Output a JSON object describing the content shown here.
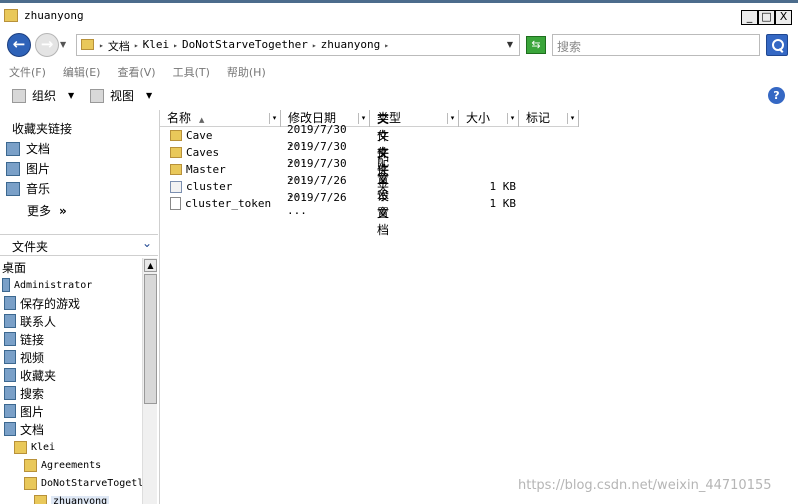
{
  "window": {
    "title": "zhuanyong",
    "minimize": "_",
    "maximize": "□",
    "close": "X"
  },
  "address": {
    "crumbs": [
      "文档",
      "Klei",
      "DoNotStarveTogether",
      "zhuanyong"
    ],
    "separator": "▸",
    "search_placeholder": "搜索"
  },
  "menu": {
    "items": [
      "文件(F)",
      "编辑(E)",
      "查看(V)",
      "工具(T)",
      "帮助(H)"
    ]
  },
  "toolbar": {
    "organize": "组织",
    "views": "视图",
    "help": "?"
  },
  "favorites": {
    "title": "收藏夹链接",
    "items": [
      {
        "label": "文档",
        "icon": "documents-icon"
      },
      {
        "label": "图片",
        "icon": "pictures-icon"
      },
      {
        "label": "音乐",
        "icon": "music-icon"
      }
    ],
    "more": "更多",
    "more_chevron": "»"
  },
  "folders": {
    "label": "文件夹",
    "chevron": "⌄",
    "tree": [
      {
        "label": "桌面",
        "indent": 0,
        "icon": "none"
      },
      {
        "label": "Administrator",
        "indent": 0,
        "icon": "user"
      },
      {
        "label": "保存的游戏",
        "indent": 0,
        "icon": "special"
      },
      {
        "label": "联系人",
        "indent": 0,
        "icon": "special"
      },
      {
        "label": "链接",
        "indent": 0,
        "icon": "special"
      },
      {
        "label": "视频",
        "indent": 0,
        "icon": "special"
      },
      {
        "label": "收藏夹",
        "indent": 0,
        "icon": "special"
      },
      {
        "label": "搜索",
        "indent": 0,
        "icon": "special"
      },
      {
        "label": "图片",
        "indent": 0,
        "icon": "special"
      },
      {
        "label": "文档",
        "indent": 0,
        "icon": "special"
      },
      {
        "label": "Klei",
        "indent": 1,
        "icon": "folder"
      },
      {
        "label": "Agreements",
        "indent": 2,
        "icon": "folder"
      },
      {
        "label": "DoNotStarveTogetl",
        "indent": 2,
        "icon": "folder"
      },
      {
        "label": "zhuanyong",
        "indent": 3,
        "icon": "folder",
        "selected": true
      }
    ]
  },
  "columns": {
    "name": "名称",
    "modified": "修改日期",
    "type": "类型",
    "size": "大小",
    "tags": "标记",
    "sort_arrow": "▲",
    "drop": "▾"
  },
  "files": [
    {
      "name": "Cave",
      "date": "2019/7/30 ...",
      "type": "文件夹",
      "size": "",
      "icon": "folder"
    },
    {
      "name": "Caves",
      "date": "2019/7/30 ...",
      "type": "文件夹",
      "size": "",
      "icon": "folder"
    },
    {
      "name": "Master",
      "date": "2019/7/30 ...",
      "type": "文件夹",
      "size": "",
      "icon": "folder"
    },
    {
      "name": "cluster",
      "date": "2019/7/26 ...",
      "type": "配置设置",
      "size": "1 KB",
      "icon": "config"
    },
    {
      "name": "cluster_token",
      "date": "2019/7/26 ...",
      "type": "文本文档",
      "size": "1 KB",
      "icon": "text"
    }
  ],
  "watermark": "https://blog.csdn.net/weixin_44710155"
}
